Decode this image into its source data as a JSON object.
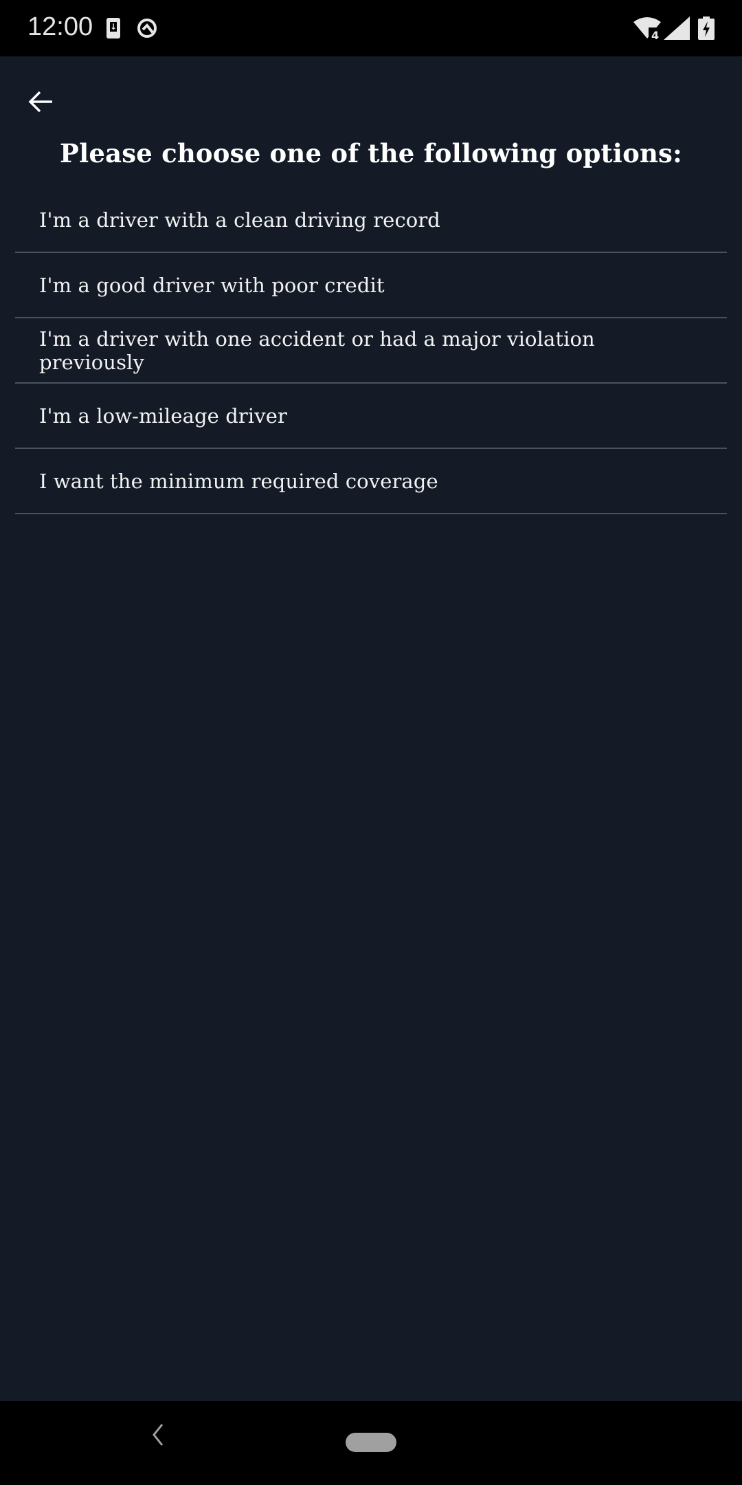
{
  "status_bar": {
    "time": "12:00",
    "icons": [
      "download-icon",
      "q-logo-icon",
      "wifi-icon",
      "signal-icon",
      "battery-charging-icon"
    ],
    "wifi_badge": "4"
  },
  "header": {
    "back_icon": "arrow-left-icon",
    "title": "Please choose one of the following options:"
  },
  "options": [
    {
      "label": "I'm a driver with a clean driving record"
    },
    {
      "label": "I'm a good driver with poor credit"
    },
    {
      "label": "I'm a driver with one accident or had a major violation previously"
    },
    {
      "label": "I'm a low-mileage driver"
    },
    {
      "label": "I want the minimum required coverage"
    }
  ],
  "nav_bar": {
    "back_icon": "chevron-left-icon",
    "home_icon": "home-pill-icon"
  },
  "colors": {
    "background": "#141b26",
    "text": "#ffffff",
    "divider": "#4a525d"
  }
}
